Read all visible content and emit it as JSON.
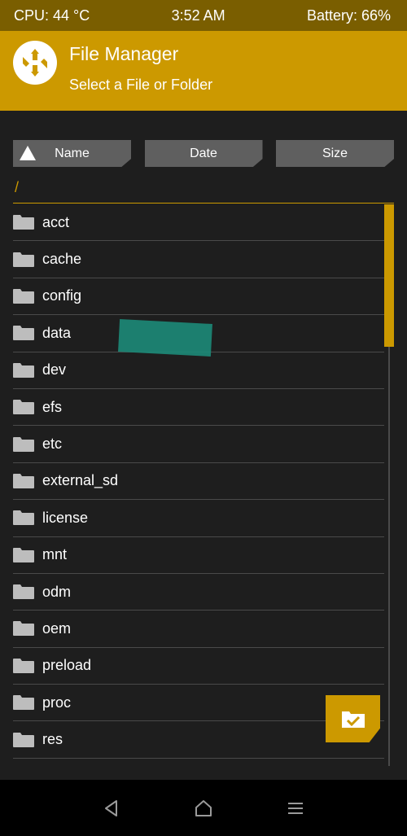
{
  "statusbar": {
    "cpu": "CPU: 44 °C",
    "time": "3:52 AM",
    "battery": "Battery: 66%"
  },
  "header": {
    "title": "File Manager",
    "subtitle": "Select a File or Folder"
  },
  "sort": {
    "name": "Name",
    "date": "Date",
    "size": "Size"
  },
  "path": "/",
  "files": [
    "acct",
    "cache",
    "config",
    "data",
    "dev",
    "efs",
    "etc",
    "external_sd",
    "license",
    "mnt",
    "odm",
    "oem",
    "preload",
    "proc",
    "res"
  ],
  "colors": {
    "accent": "#cc9900",
    "status_bg": "#7a5e00",
    "background": "#1e1e1e",
    "button": "#5f5f5f"
  },
  "icons": {
    "logo": "twrp-logo-icon",
    "folder": "folder-icon",
    "select": "select-folder-icon",
    "back": "back-icon",
    "home": "home-icon",
    "menu": "menu-icon"
  }
}
